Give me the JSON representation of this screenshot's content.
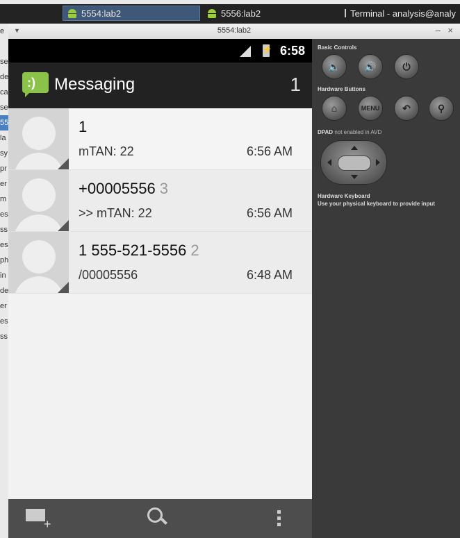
{
  "taskbar": {
    "tasks": [
      {
        "label": "5554:lab2",
        "icon": "android-icon",
        "active": true
      },
      {
        "label": "5556:lab2",
        "icon": "android-icon",
        "active": false
      },
      {
        "label": "Terminal - analysis@analy",
        "icon": "terminal-icon",
        "active": false
      }
    ]
  },
  "left_strip": [
    "e",
    "",
    "se",
    "de",
    "ca",
    "se",
    "la",
    "sy",
    "pr",
    "er",
    "m",
    "es",
    "ss",
    "es",
    "ph",
    "in",
    "de",
    "55",
    "er",
    "es",
    "ss"
  ],
  "window": {
    "title": "5554:lab2",
    "minimize": "–",
    "close": "×"
  },
  "phone": {
    "status_time": "6:58",
    "app_title": "Messaging",
    "unread_count": "1",
    "conversations": [
      {
        "name": "1",
        "count": "",
        "snippet": "mTAN: 22",
        "time": "6:56 AM"
      },
      {
        "name": "+00005556",
        "count": "3",
        "snippet": ">> mTAN: 22",
        "time": "6:56 AM"
      },
      {
        "name": "1 555-521-5556",
        "count": "2",
        "snippet": "/00005556",
        "time": "6:48 AM"
      }
    ]
  },
  "controls": {
    "basic_label": "Basic Controls",
    "hardware_label": "Hardware Buttons",
    "menu_label": "MENU",
    "dpad_label_bold": "DPAD",
    "dpad_label_rest": "not enabled in AVD",
    "keyboard_label": "Hardware Keyboard",
    "keyboard_note": "Use your physical keyboard to provide input"
  }
}
